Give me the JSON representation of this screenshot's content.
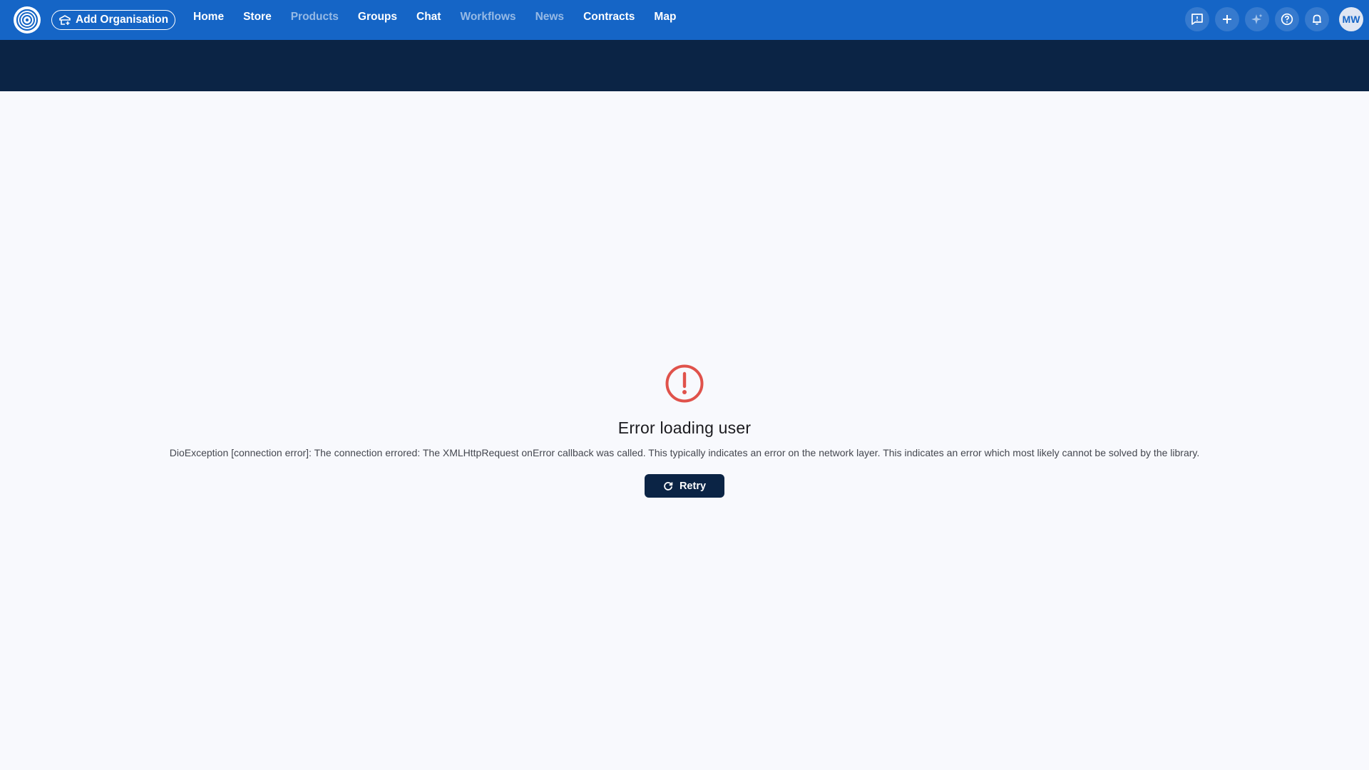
{
  "header": {
    "add_org_label": "Add Organisation",
    "nav": [
      {
        "label": "Home",
        "dim": false
      },
      {
        "label": "Store",
        "dim": false
      },
      {
        "label": "Products",
        "dim": true
      },
      {
        "label": "Groups",
        "dim": false
      },
      {
        "label": "Chat",
        "dim": false
      },
      {
        "label": "Workflows",
        "dim": true
      },
      {
        "label": "News",
        "dim": true
      },
      {
        "label": "Contracts",
        "dim": false
      },
      {
        "label": "Map",
        "dim": false
      }
    ],
    "actions": [
      "feedback-icon",
      "plus-icon",
      "sparkle-icon",
      "help-icon",
      "bell-icon"
    ],
    "avatar_initials": "MW"
  },
  "error": {
    "icon": "alert-circle-icon",
    "title": "Error loading user",
    "message": "DioException [connection error]: The connection errored: The XMLHttpRequest onError callback was called. This typically indicates an error on the network layer. This indicates an error which most likely cannot be solved by the library.",
    "retry_label": "Retry"
  },
  "colors": {
    "topbar": "#1565c6",
    "banner": "#0b2445",
    "background": "#f8f9fd",
    "error_icon": "#e0524b",
    "retry_button": "#0b2445"
  }
}
